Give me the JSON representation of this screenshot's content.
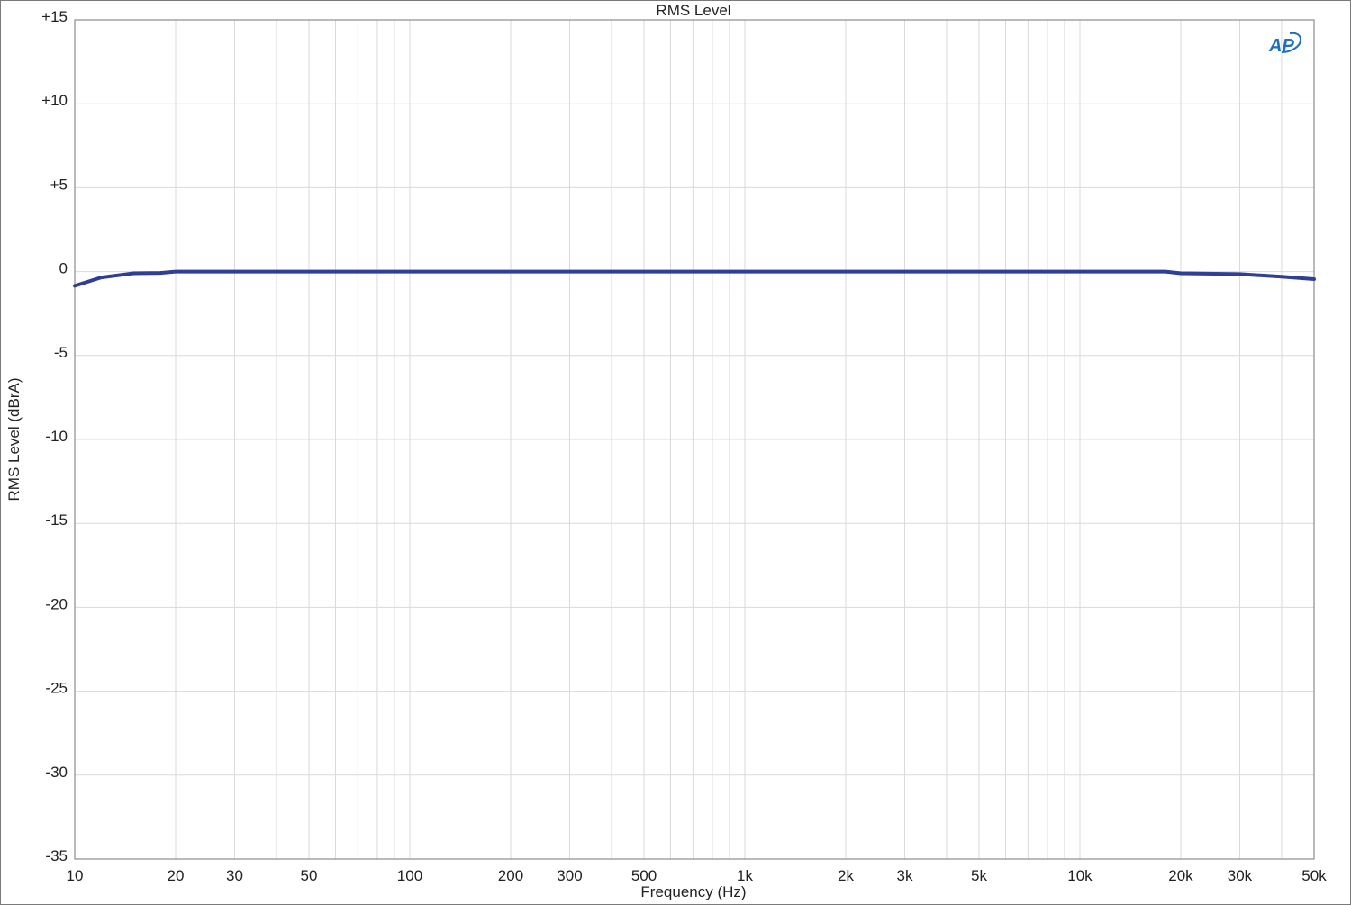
{
  "chart_data": {
    "type": "line",
    "title": "RMS Level",
    "xlabel": "Frequency (Hz)",
    "ylabel": "RMS Level (dBrA)",
    "x_scale": "log",
    "xlim": [
      10,
      50000
    ],
    "ylim": [
      -35,
      15
    ],
    "grid": true,
    "x_ticks": [
      {
        "value": 10,
        "label": "10"
      },
      {
        "value": 20,
        "label": "20"
      },
      {
        "value": 30,
        "label": "30"
      },
      {
        "value": 50,
        "label": "50"
      },
      {
        "value": 100,
        "label": "100"
      },
      {
        "value": 200,
        "label": "200"
      },
      {
        "value": 300,
        "label": "300"
      },
      {
        "value": 500,
        "label": "500"
      },
      {
        "value": 1000,
        "label": "1k"
      },
      {
        "value": 2000,
        "label": "2k"
      },
      {
        "value": 3000,
        "label": "3k"
      },
      {
        "value": 5000,
        "label": "5k"
      },
      {
        "value": 10000,
        "label": "10k"
      },
      {
        "value": 20000,
        "label": "20k"
      },
      {
        "value": 30000,
        "label": "30k"
      },
      {
        "value": 50000,
        "label": "50k"
      }
    ],
    "y_ticks": [
      {
        "value": 15,
        "label": "+15"
      },
      {
        "value": 10,
        "label": "+10"
      },
      {
        "value": 5,
        "label": "+5"
      },
      {
        "value": 0,
        "label": "0"
      },
      {
        "value": -5,
        "label": "-5"
      },
      {
        "value": -10,
        "label": "-10"
      },
      {
        "value": -15,
        "label": "-15"
      },
      {
        "value": -20,
        "label": "-20"
      },
      {
        "value": -25,
        "label": "-25"
      },
      {
        "value": -30,
        "label": "-30"
      },
      {
        "value": -35,
        "label": "-35"
      }
    ],
    "series": [
      {
        "color": "#2e3f95",
        "points": [
          [
            10,
            -0.85
          ],
          [
            12,
            -0.35
          ],
          [
            15,
            -0.1
          ],
          [
            18,
            -0.08
          ],
          [
            20,
            0.0
          ],
          [
            50,
            0.0
          ],
          [
            100,
            0.0
          ],
          [
            1000,
            0.0
          ],
          [
            10000,
            0.0
          ],
          [
            18000,
            0.0
          ],
          [
            20000,
            -0.1
          ],
          [
            30000,
            -0.15
          ],
          [
            40000,
            -0.3
          ],
          [
            50000,
            -0.45
          ]
        ]
      }
    ],
    "logo": "AP"
  },
  "colors": {
    "grid": "#d9d9d9",
    "axis": "#8c8c8c",
    "line": "#2e3f95",
    "logo": "#1f6fbf"
  }
}
